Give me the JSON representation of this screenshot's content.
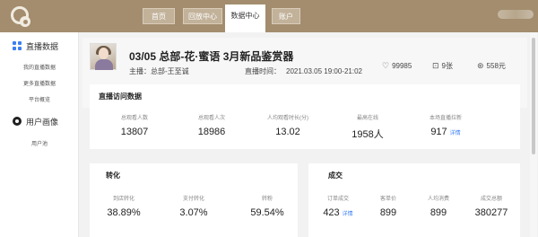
{
  "nav": {
    "tabs": [
      {
        "label": "首页"
      },
      {
        "label": "回放中心"
      },
      {
        "label": "数据中心"
      },
      {
        "label": "账户"
      }
    ]
  },
  "sidebar": {
    "sections": [
      {
        "title": "直播数据",
        "items": [
          "我的直播数据",
          "更多直播数据",
          "平台概览"
        ]
      },
      {
        "title": "用户画像",
        "items": [
          "用户池"
        ]
      }
    ]
  },
  "live": {
    "title": "03/05 总部-花·蜜语 3月新品鉴赏器",
    "host_label": "主播：总部-王至诚",
    "time_label": "直播时间：",
    "time_value": "2021.03.05 19:00-21:02",
    "likes": "99985",
    "products": "9张",
    "sales": "558元"
  },
  "live_data": {
    "title": "直播访问数据",
    "metrics": [
      {
        "label": "总观看人数",
        "value": "13807"
      },
      {
        "label": "总观看人次",
        "value": "18986"
      },
      {
        "label": "人均观看时长(分)",
        "value": "13.02"
      },
      {
        "label": "最高在线",
        "value": "1958人"
      },
      {
        "label": "本场直播拉新",
        "value": "917",
        "link": "详情"
      }
    ]
  },
  "conversion": {
    "title": "转化",
    "metrics": [
      {
        "label": "到店转化",
        "value": "38.89%"
      },
      {
        "label": "支付转化",
        "value": "3.07%"
      },
      {
        "label": "转粉",
        "value": "59.54%"
      }
    ]
  },
  "deal": {
    "title": "成交",
    "metrics": [
      {
        "label": "订单成交",
        "value": "423",
        "link": "详情"
      },
      {
        "label": "客单价",
        "value": "899"
      },
      {
        "label": "人均消费",
        "value": "899"
      },
      {
        "label": "成交总额",
        "value": "380277"
      }
    ]
  },
  "icons": {
    "likes": "heart-icon",
    "products": "product-icon",
    "sales": "money-icon"
  },
  "colors": {
    "nav_bg": "#a38d6e",
    "accent": "#3b7ff2"
  }
}
